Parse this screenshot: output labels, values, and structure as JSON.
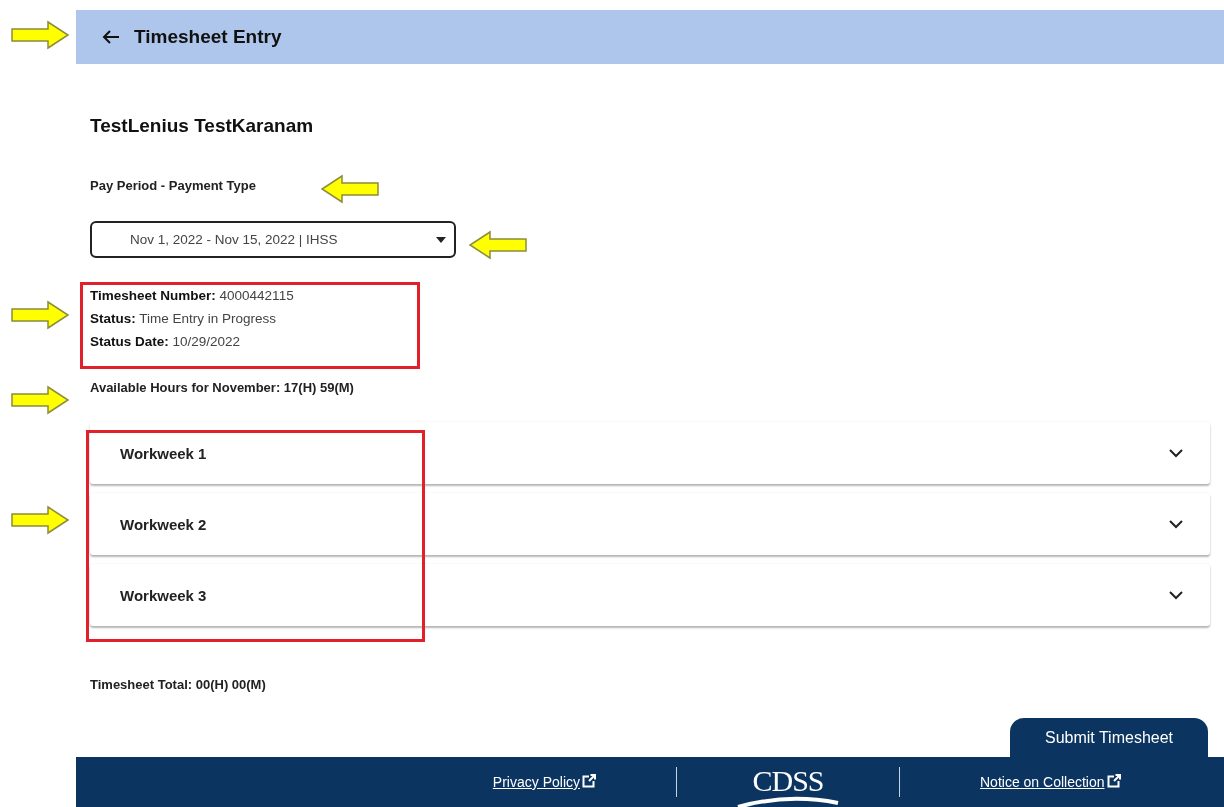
{
  "header": {
    "title": "Timesheet Entry"
  },
  "worker_name": "TestLenius TestKaranam",
  "pay_period": {
    "label": "Pay Period - Payment Type",
    "value": "Nov 1, 2022 - Nov 15, 2022 | IHSS"
  },
  "details": [
    {
      "label": "Timesheet Number:",
      "value": "4000442115"
    },
    {
      "label": "Status:",
      "value": "Time Entry in Progress"
    },
    {
      "label": "Status Date:",
      "value": "10/29/2022"
    }
  ],
  "available_hours": "Available Hours for November: 17(H) 59(M)",
  "workweeks": [
    {
      "title": "Workweek 1",
      "expanded": false
    },
    {
      "title": "Workweek 2",
      "expanded": false
    },
    {
      "title": "Workweek 3",
      "expanded": false
    }
  ],
  "timesheet_total": "Timesheet Total: 00(H) 00(M)",
  "submit_button": "Submit Timesheet",
  "footer": {
    "links": [
      "Privacy Policy",
      "Notice on Collection"
    ],
    "logo": "CDSS"
  }
}
